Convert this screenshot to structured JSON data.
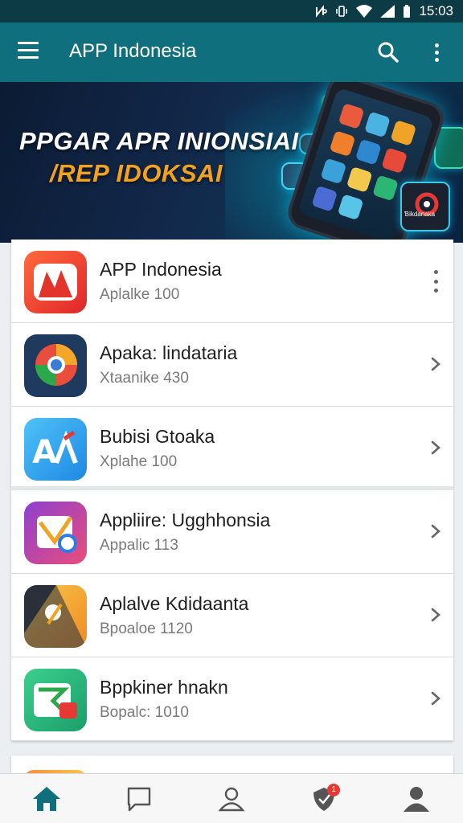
{
  "status_bar": {
    "time": "15:03",
    "icons": [
      "nfc-icon",
      "vibrate-icon",
      "wifi-icon",
      "signal-icon",
      "battery-icon"
    ]
  },
  "app_bar": {
    "title": "APP Indonesia",
    "icons": [
      "menu-icon",
      "search-icon",
      "more-vert-icon"
    ]
  },
  "banner": {
    "line1": "PPGAR APR INIONSIAI",
    "line2": "/REP IDOKSAI",
    "phone_icon_label": "Ɓikdanaka"
  },
  "list": {
    "items": [
      {
        "title": "APP Indonesia",
        "subtitle": "Aplalke 100",
        "trailing": "more-vert-icon"
      },
      {
        "title": "Apaka: lindataria",
        "subtitle": "Xtaanike 430",
        "trailing": "chevron-right-icon"
      },
      {
        "title": "Bubisi Gtoaka",
        "subtitle": "Xplahe 100",
        "trailing": "chevron-right-icon"
      },
      {
        "title": "Appliire: Ugghhonsia",
        "subtitle": "Appalic 113",
        "trailing": "chevron-right-icon"
      },
      {
        "title": "Aplalve Kdidaanta",
        "subtitle": "Bpoaloe 1120",
        "trailing": "chevron-right-icon"
      },
      {
        "title": "Bppkiner hnakn",
        "subtitle": "Bopalc: 1010",
        "trailing": "chevron-right-icon"
      }
    ]
  },
  "bottom_nav": {
    "items": [
      "home-icon",
      "chat-icon",
      "profile-icon",
      "shield-icon",
      "account-icon"
    ],
    "badge": "1",
    "active_color": "#0f6f7d"
  },
  "colors": {
    "app_bar": "#106f7d",
    "status_bar": "#0c3b45",
    "banner_accent": "#f2a21c"
  }
}
